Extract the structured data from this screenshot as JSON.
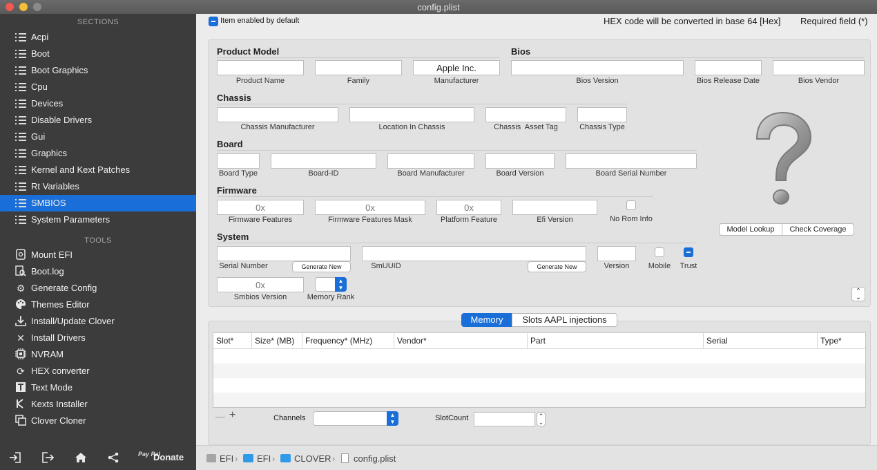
{
  "window": {
    "title": "config.plist"
  },
  "sidebar": {
    "sections_header": "SECTIONS",
    "tools_header": "TOOLS",
    "sections": [
      {
        "label": "Acpi"
      },
      {
        "label": "Boot"
      },
      {
        "label": "Boot Graphics"
      },
      {
        "label": "Cpu"
      },
      {
        "label": "Devices"
      },
      {
        "label": "Disable Drivers"
      },
      {
        "label": "Gui"
      },
      {
        "label": "Graphics"
      },
      {
        "label": "Kernel and Kext Patches"
      },
      {
        "label": "Rt Variables"
      },
      {
        "label": "SMBIOS",
        "active": true
      },
      {
        "label": "System Parameters"
      }
    ],
    "tools": [
      {
        "label": "Mount EFI",
        "icon": "drive-icon"
      },
      {
        "label": "Boot.log",
        "icon": "log-icon"
      },
      {
        "label": "Generate Config",
        "icon": "gears-icon"
      },
      {
        "label": "Themes Editor",
        "icon": "palette-icon"
      },
      {
        "label": "Install/Update Clover",
        "icon": "download-icon"
      },
      {
        "label": "Install Drivers",
        "icon": "tools-icon"
      },
      {
        "label": "NVRAM",
        "icon": "chip-icon"
      },
      {
        "label": "HEX converter",
        "icon": "refresh-icon"
      },
      {
        "label": "Text Mode",
        "icon": "text-icon"
      },
      {
        "label": "Kexts Installer",
        "icon": "kext-icon"
      },
      {
        "label": "Clover Cloner",
        "icon": "clone-icon"
      }
    ],
    "bottom": {
      "paypal": "Pay Pal",
      "donate": "Donate"
    }
  },
  "header": {
    "enabled_label": "Item enabled by default",
    "hex_note": "HEX code will be converted in base 64 [Hex]",
    "required_note": "Required field (*)"
  },
  "product_model": {
    "title": "Product Model",
    "product_name": {
      "label": "Product Name",
      "value": ""
    },
    "family": {
      "label": "Family",
      "value": ""
    },
    "manufacturer": {
      "label": "Manufacturer",
      "value": "Apple Inc."
    }
  },
  "bios": {
    "title": "Bios",
    "version": {
      "label": "Bios Version",
      "value": ""
    },
    "release_date": {
      "label": "Bios Release Date",
      "value": ""
    },
    "vendor": {
      "label": "Bios Vendor",
      "value": ""
    }
  },
  "chassis": {
    "title": "Chassis",
    "manufacturer": {
      "label": "Chassis Manufacturer",
      "value": ""
    },
    "location": {
      "label": "Location In Chassis",
      "value": ""
    },
    "asset_tag": {
      "label": "Chassis  Asset Tag",
      "value": ""
    },
    "type": {
      "label": "Chassis Type",
      "value": ""
    }
  },
  "board": {
    "title": "Board",
    "type": {
      "label": "Board Type",
      "value": ""
    },
    "id": {
      "label": "Board-ID",
      "value": ""
    },
    "manufacturer": {
      "label": "Board Manufacturer",
      "value": ""
    },
    "version": {
      "label": "Board Version",
      "value": ""
    },
    "serial": {
      "label": "Board Serial Number",
      "value": ""
    }
  },
  "firmware": {
    "title": "Firmware",
    "features": {
      "label": "Firmware Features",
      "placeholder": "0x"
    },
    "features_mask": {
      "label": "Firmware Features Mask",
      "placeholder": "0x"
    },
    "platform_feature": {
      "label": "Platform Feature",
      "placeholder": "0x"
    },
    "efi_version": {
      "label": "Efi Version",
      "value": ""
    },
    "no_rom_info": {
      "label": "No Rom Info",
      "checked": false
    }
  },
  "system": {
    "title": "System",
    "serial_number": {
      "label": "Serial Number",
      "value": ""
    },
    "generate_new": "Generate New",
    "smuuid": {
      "label": "SmUUID",
      "value": ""
    },
    "version": {
      "label": "Version",
      "value": ""
    },
    "mobile": {
      "label": "Mobile",
      "checked": false
    },
    "trust": {
      "label": "Trust",
      "checked": true
    },
    "smbios_version": {
      "label": "Smbios Version",
      "placeholder": "0x"
    },
    "memory_rank": {
      "label": "Memory Rank",
      "value": ""
    }
  },
  "lookup": {
    "placeholder_glyph": "?",
    "model_lookup": "Model Lookup",
    "check_coverage": "Check Coverage"
  },
  "memory": {
    "tabs": [
      {
        "label": "Memory",
        "active": true
      },
      {
        "label": "Slots AAPL injections"
      }
    ],
    "columns": [
      "Slot*",
      "Size* (MB)",
      "Frequency* (MHz)",
      "Vendor*",
      "Part",
      "Serial",
      "Type*"
    ],
    "rows": [],
    "remove": "—",
    "add": "+",
    "channels_label": "Channels",
    "channels_value": "",
    "slotcount_label": "SlotCount",
    "slotcount_value": ""
  },
  "pathbar": {
    "segments": [
      "EFI",
      "EFI",
      "CLOVER",
      "config.plist"
    ],
    "separator": "›"
  },
  "colors": {
    "accent": "#1a6ed8",
    "sidebar": "#3c3c3c",
    "panel": "#ececec"
  }
}
